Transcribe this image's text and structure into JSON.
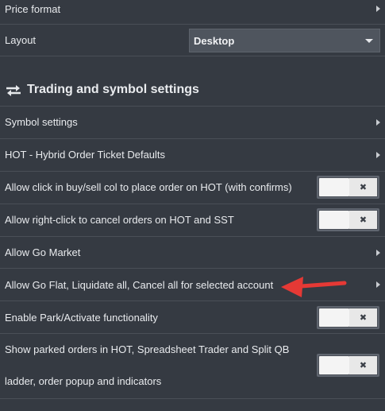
{
  "rows": {
    "price_format": "Price format",
    "layout": "Layout",
    "symbol_settings": "Symbol settings",
    "hot_defaults": "HOT - Hybrid Order Ticket Defaults",
    "allow_click": "Allow click in buy/sell col to place order on HOT (with confirms)",
    "allow_right_click": "Allow right-click to cancel orders on HOT and SST",
    "allow_go_market": "Allow Go Market",
    "allow_go_flat": "Allow Go Flat, Liquidate all, Cancel all for selected account",
    "enable_park": "Enable Park/Activate functionality",
    "show_parked_line1": "Show parked orders in HOT, Spreadsheet Trader and Split QB",
    "show_parked_line2": "ladder, order popup and indicators"
  },
  "layout_select": {
    "value": "Desktop"
  },
  "section": {
    "title": "Trading and symbol settings"
  },
  "toggle": {
    "x_glyph": "✖"
  },
  "icons": {
    "chevron": "chevron-right-icon",
    "section": "swap-arrows-icon",
    "annotation": "red-arrow-annotation"
  },
  "colors": {
    "background": "#353a42",
    "annotation": "#e53935"
  }
}
